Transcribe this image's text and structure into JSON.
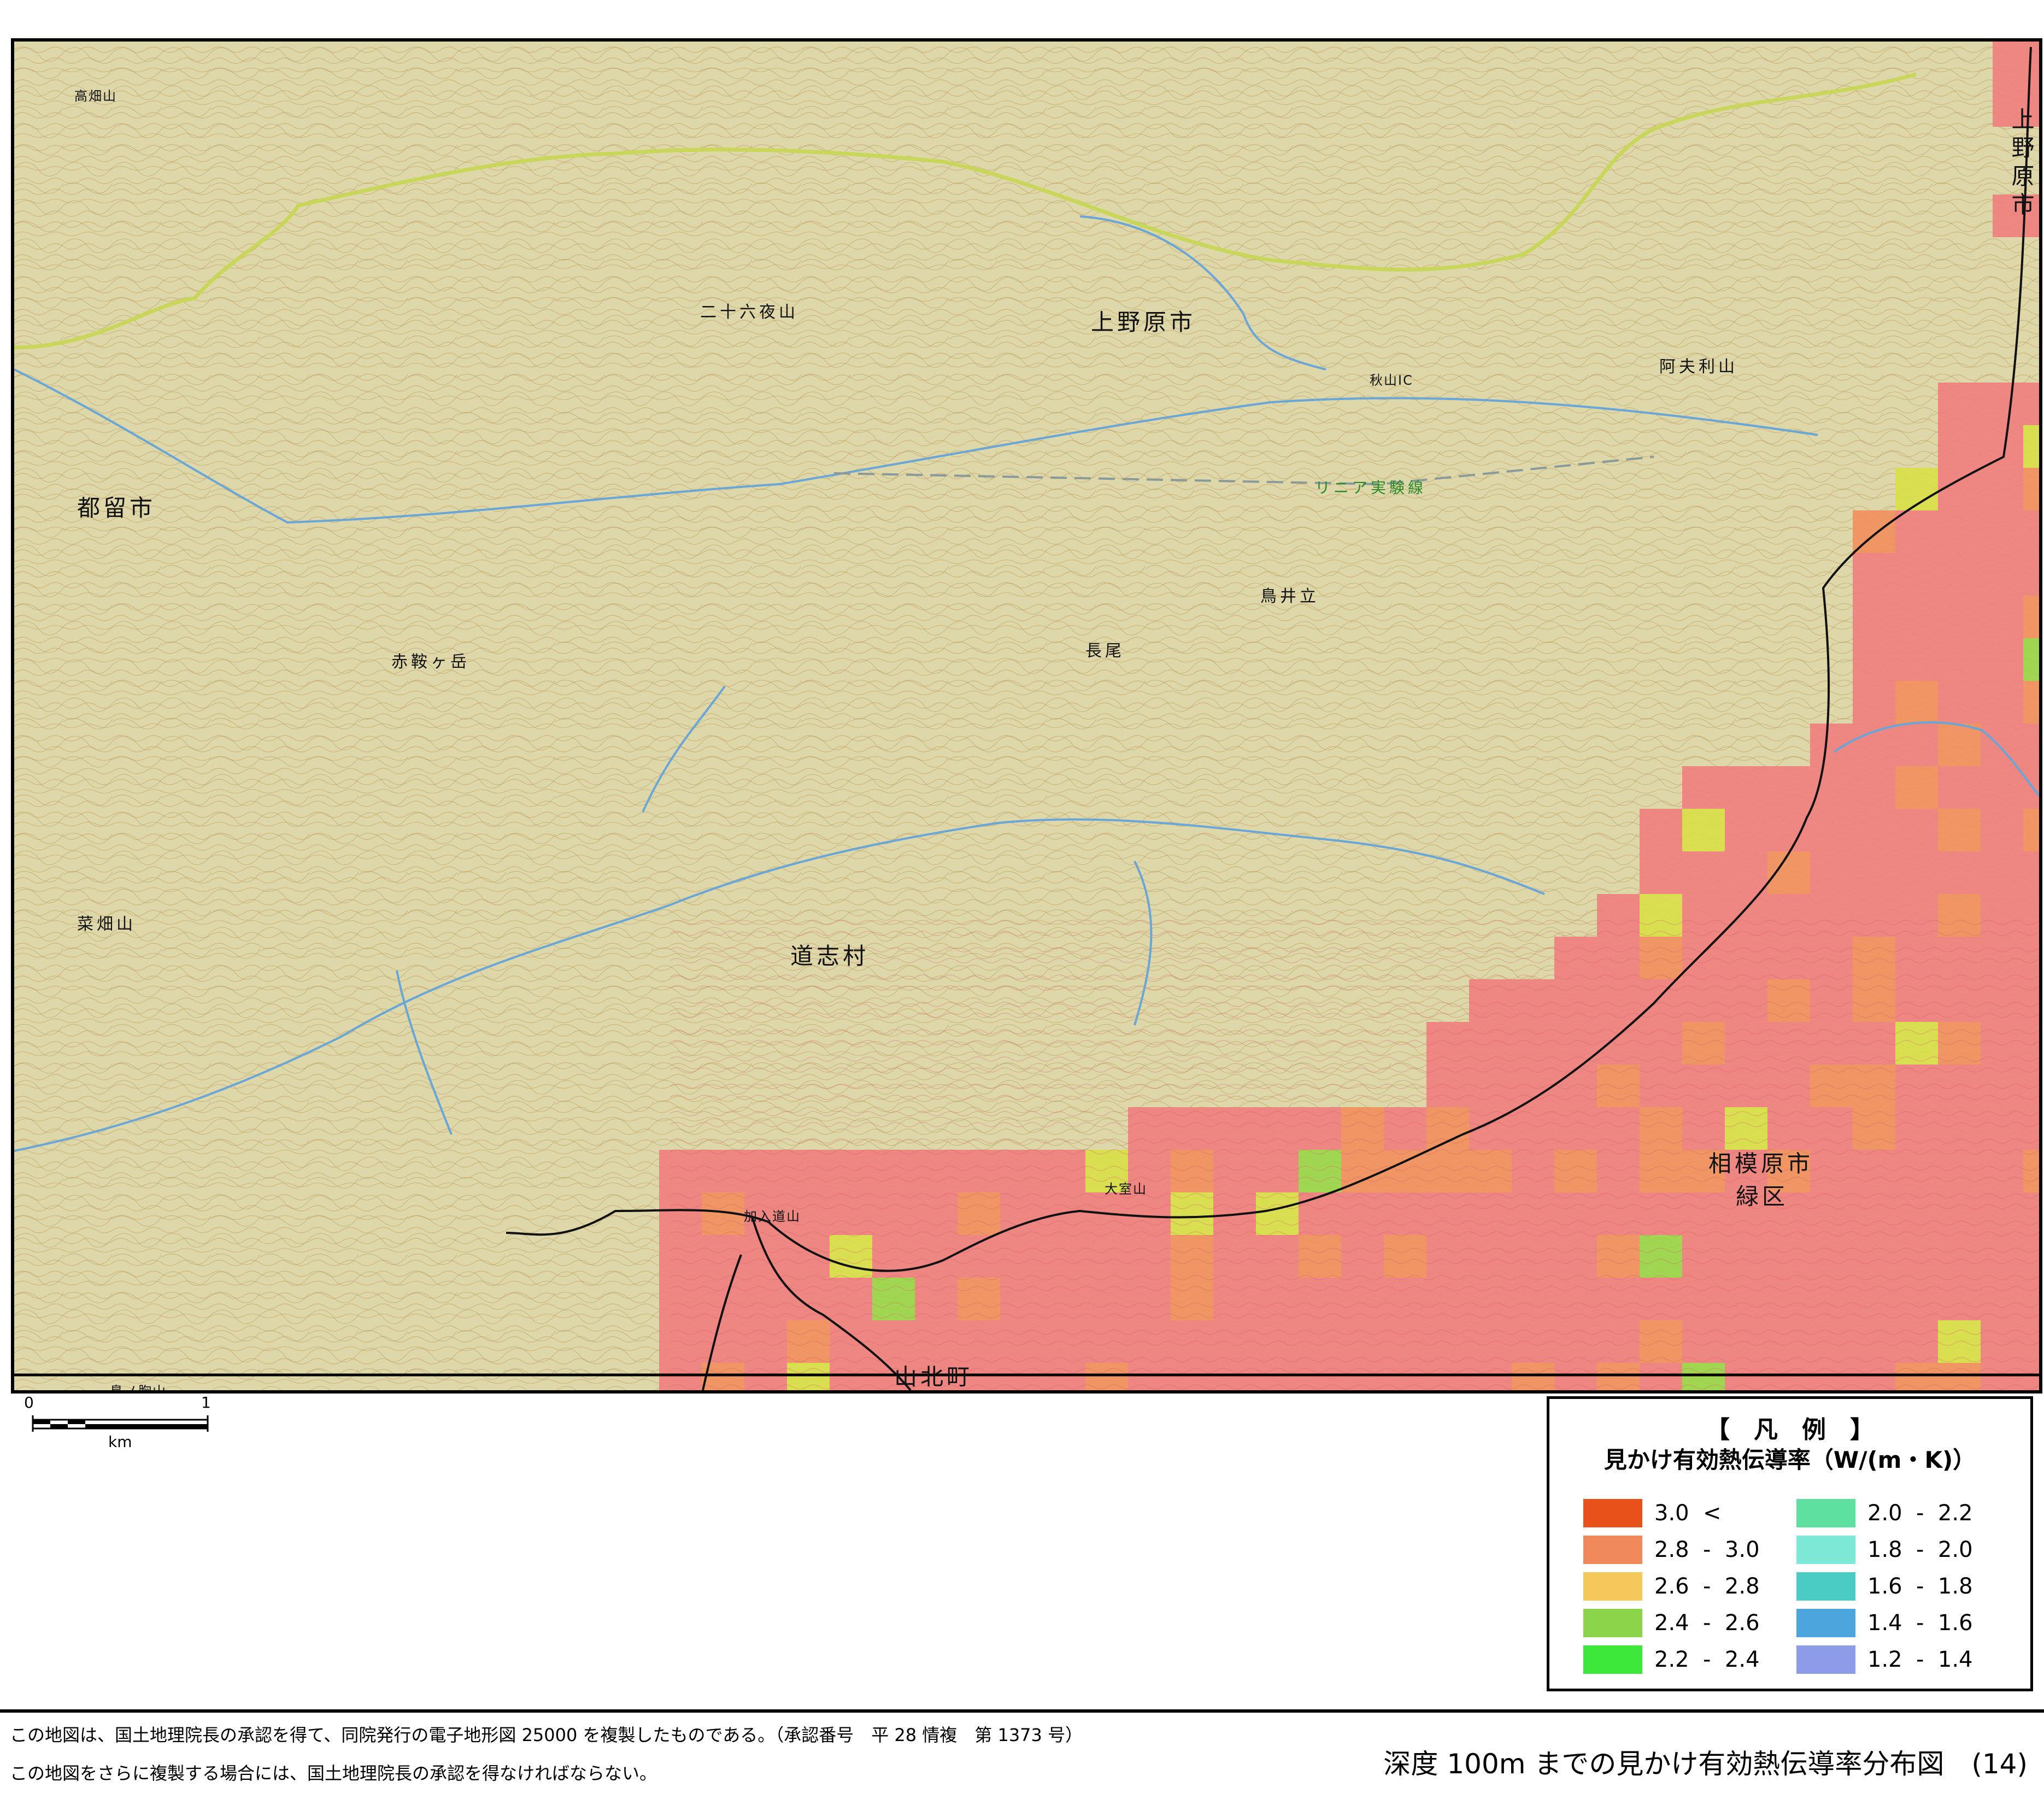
{
  "map": {
    "places": [
      {
        "id": "uenohara-city",
        "text": "上野原市"
      },
      {
        "id": "uenohara-right",
        "text": "上野原市"
      },
      {
        "id": "tsuru-city",
        "text": "都留市"
      },
      {
        "id": "doshi-village",
        "text": "道志村"
      },
      {
        "id": "sagamihara-city",
        "text": "相模原市"
      },
      {
        "id": "midori-ku",
        "text": "緑区"
      },
      {
        "id": "yamakita-town",
        "text": "山北町"
      },
      {
        "id": "linear-line",
        "text": "リニア実験線"
      },
      {
        "id": "nijurokuya",
        "text": "二十六夜山"
      },
      {
        "id": "akiyama",
        "text": "阿夫利山"
      },
      {
        "id": "akabatsu",
        "text": "赤鞍ヶ岳"
      },
      {
        "id": "nagao",
        "text": "長尾"
      },
      {
        "id": "torii",
        "text": "鳥井立"
      },
      {
        "id": "tanabe",
        "text": "菜畑山"
      },
      {
        "id": "kanyu",
        "text": "加入道山"
      },
      {
        "id": "omuro",
        "text": "大室山"
      },
      {
        "id": "takahata",
        "text": "高畑山"
      },
      {
        "id": "torinosuyama",
        "text": "鳥ノ胸山"
      },
      {
        "id": "akiyama-ic",
        "text": "秋山IC"
      }
    ],
    "scale": {
      "zero": "0",
      "one": "1",
      "unit": "km"
    },
    "colors": {
      "base": "#ddd7a9",
      "contour": "#c8a96a",
      "river": "#6aa6d6",
      "road": "#c8d65a",
      "boundary": "#111111"
    }
  },
  "legend": {
    "title": "【　凡　例　】",
    "subtitle": "見かけ有効熱伝導率（W/(m・K)）",
    "items": [
      {
        "color": "#e8511a",
        "label": "3.0  <"
      },
      {
        "color": "#f08a5a",
        "label": "2.8  -  3.0"
      },
      {
        "color": "#f4c85a",
        "label": "2.6  -  2.8"
      },
      {
        "color": "#8cd44a",
        "label": "2.4  -  2.6"
      },
      {
        "color": "#3ee83a",
        "label": "2.2  -  2.4"
      },
      {
        "color": "#5ee0a0",
        "label": "2.0  -  2.2"
      },
      {
        "color": "#7ee8d6",
        "label": "1.8  -  2.0"
      },
      {
        "color": "#4accc4",
        "label": "1.6  -  1.8"
      },
      {
        "color": "#4aa6dc",
        "label": "1.4  -  1.6"
      },
      {
        "color": "#8c9ce8",
        "label": "1.2  -  1.4"
      }
    ]
  },
  "footer": {
    "note1": "この地図は、国土地理院長の承認を得て、同院発行の電子地形図 25000 を複製したものである。（承認番号　平 28 情複　第 1373 号）",
    "note2": "この地図をさらに複製する場合には、国土地理院長の承認を得なければならない。",
    "title": "深度 100m までの見かけ有効熱伝導率分布図　(14)"
  },
  "overlay_colors": {
    "pink": "#ef7f7f",
    "salmon": "#f0905e",
    "yellow": "#d8e04a",
    "green": "#9ad64a"
  }
}
